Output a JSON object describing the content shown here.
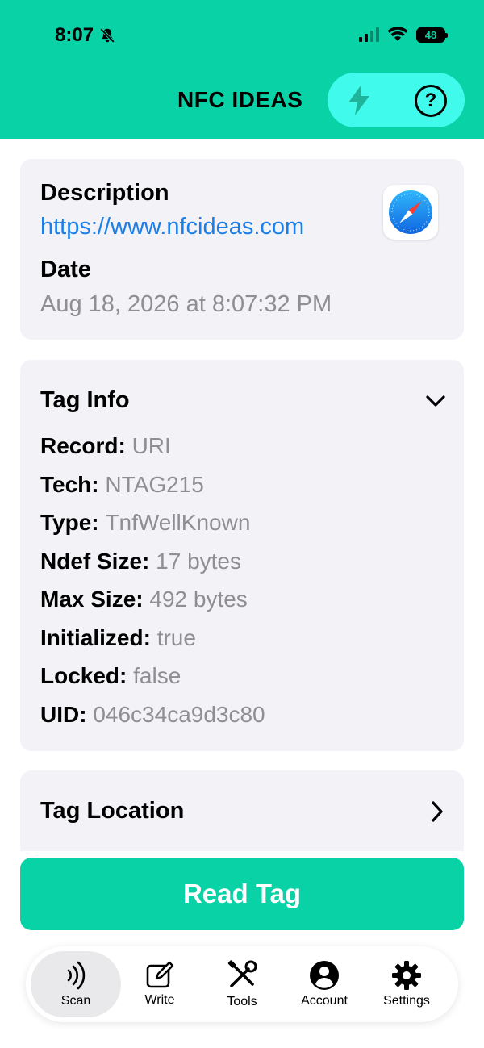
{
  "status": {
    "time": "8:07",
    "battery": "48"
  },
  "header": {
    "title": "NFC IDEAS",
    "help_glyph": "?"
  },
  "record": {
    "description_label": "Description",
    "description_value": "https://www.nfcideas.com",
    "date_label": "Date",
    "date_value": "Aug 18, 2026 at 8:07:32 PM"
  },
  "tag_info": {
    "title": "Tag Info",
    "rows": [
      {
        "key": "Record:",
        "value": "URI"
      },
      {
        "key": "Tech:",
        "value": "NTAG215"
      },
      {
        "key": "Type:",
        "value": "TnfWellKnown"
      },
      {
        "key": "Ndef Size:",
        "value": "17 bytes"
      },
      {
        "key": "Max Size:",
        "value": "492 bytes"
      },
      {
        "key": "Initialized:",
        "value": "true"
      },
      {
        "key": "Locked:",
        "value": "false"
      },
      {
        "key": "UID:",
        "value": "046c34ca9d3c80"
      }
    ]
  },
  "tag_location": {
    "title": "Tag Location"
  },
  "read_button": {
    "label": "Read Tag"
  },
  "tabs": [
    {
      "label": "Scan"
    },
    {
      "label": "Write"
    },
    {
      "label": "Tools"
    },
    {
      "label": "Account"
    },
    {
      "label": "Settings"
    }
  ],
  "colors": {
    "accent": "#08d2a6",
    "pill": "#40fbec",
    "link": "#1a7fe8",
    "muted": "#8e8e93",
    "card": "#f2f2f7"
  }
}
